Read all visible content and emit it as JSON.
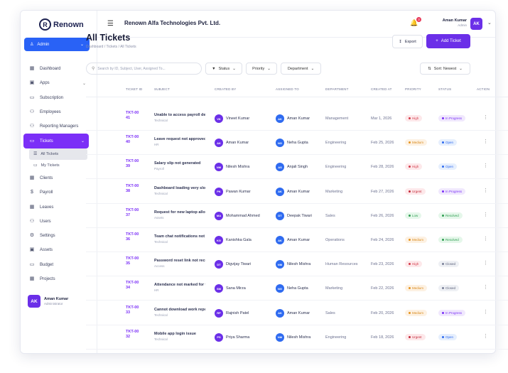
{
  "brand": {
    "name": "Renown",
    "mark": "R"
  },
  "role_switch": {
    "label": "Admin"
  },
  "sidebar": {
    "items": [
      {
        "label": "Dashboard",
        "icon": "grid-icon"
      },
      {
        "label": "Apps",
        "icon": "apps-icon",
        "has_children": true
      },
      {
        "label": "Subscription",
        "icon": "card-icon"
      },
      {
        "label": "Employees",
        "icon": "users-icon"
      },
      {
        "label": "Reporting Managers",
        "icon": "manager-icon"
      },
      {
        "label": "Tickets",
        "icon": "ticket-icon",
        "active": true,
        "has_children": true
      },
      {
        "label": "Clients",
        "icon": "building-icon"
      },
      {
        "label": "Payroll",
        "icon": "dollar-icon"
      },
      {
        "label": "Leaves",
        "icon": "calendar-icon"
      },
      {
        "label": "Users",
        "icon": "user-group-icon"
      },
      {
        "label": "Settings",
        "icon": "gear-icon"
      },
      {
        "label": "Assets",
        "icon": "box-icon"
      },
      {
        "label": "Budget",
        "icon": "wallet-icon"
      },
      {
        "label": "Projects",
        "icon": "folder-icon"
      }
    ],
    "tickets_children": [
      {
        "label": "All Tickets",
        "selected": true
      },
      {
        "label": "My Tickets",
        "selected": false
      }
    ],
    "footer_user": {
      "initials": "AK",
      "name": "Aman Kumar",
      "role": "Administrator"
    }
  },
  "topbar": {
    "company": "Renown Alfa Technologies Pvt. Ltd.",
    "notifications": "3",
    "user": {
      "name": "Aman Kumar",
      "role": "Admin",
      "initials": "AK"
    }
  },
  "page": {
    "title": "All Tickets",
    "breadcrumb": "Dashboard / Tickets / All Tickets",
    "export_label": "Export",
    "add_label": "Add Ticket"
  },
  "filters": {
    "search_placeholder": "Search by ID, Subject, User, Assigned To...",
    "status": "Status",
    "priority": "Priority",
    "department": "Department",
    "sort": "Sort: Newest"
  },
  "table": {
    "headers": [
      "TICKET ID",
      "SUBJECT",
      "CREATED BY",
      "ASSIGNED TO",
      "DEPARTMENT",
      "CREATED AT",
      "PRIORITY",
      "STATUS",
      "ACTION"
    ],
    "rows": [
      {
        "id": "TKT-0041",
        "subject": "Unable to access payroll details",
        "category": "Technical",
        "created_by": {
          "initials": "VK",
          "name": "Vineet Kumar"
        },
        "assigned_to": {
          "initials": "AK",
          "name": "Aman Kumar"
        },
        "department": "Management",
        "created_at": "Mar 1, 2026",
        "priority": "High",
        "status": "In Progress"
      },
      {
        "id": "TKT-0040",
        "subject": "Leave request not approved",
        "category": "HR",
        "created_by": {
          "initials": "AK",
          "name": "Aman Kumar"
        },
        "assigned_to": {
          "initials": "NG",
          "name": "Neha Gupta"
        },
        "department": "Engineering",
        "created_at": "Feb 25, 2026",
        "priority": "Medium",
        "status": "Open"
      },
      {
        "id": "TKT-0039",
        "subject": "Salary slip not generated",
        "category": "Payroll",
        "created_by": {
          "initials": "NM",
          "name": "Nilesh Mishra"
        },
        "assigned_to": {
          "initials": "AS",
          "name": "Anjali Singh"
        },
        "department": "Engineering",
        "created_at": "Feb 28, 2026",
        "priority": "High",
        "status": "Open"
      },
      {
        "id": "TKT-0038",
        "subject": "Dashboard loading very slow",
        "category": "Technical",
        "created_by": {
          "initials": "PK",
          "name": "Pawan Kumar"
        },
        "assigned_to": {
          "initials": "AK",
          "name": "Aman Kumar"
        },
        "department": "Marketing",
        "created_at": "Feb 27, 2026",
        "priority": "Urgent",
        "status": "In Progress"
      },
      {
        "id": "TKT-0037",
        "subject": "Request for new laptop allocation",
        "category": "Assets",
        "created_by": {
          "initials": "MA",
          "name": "Mohammad Ahmed"
        },
        "assigned_to": {
          "initials": "DT",
          "name": "Deepak Tiwari"
        },
        "department": "Sales",
        "created_at": "Feb 26, 2026",
        "priority": "Low",
        "status": "Resolved"
      },
      {
        "id": "TKT-0036",
        "subject": "Team chat notifications not working",
        "category": "Technical",
        "created_by": {
          "initials": "KG",
          "name": "Kanishka Gala"
        },
        "assigned_to": {
          "initials": "AK",
          "name": "Aman Kumar"
        },
        "department": "Operations",
        "created_at": "Feb 24, 2026",
        "priority": "Medium",
        "status": "Resolved"
      },
      {
        "id": "TKT-0035",
        "subject": "Password reset link not received",
        "category": "Access",
        "created_by": {
          "initials": "DT",
          "name": "Digvijay Tiwari"
        },
        "assigned_to": {
          "initials": "NM",
          "name": "Nilesh Mishra"
        },
        "department": "Human Resources",
        "created_at": "Feb 23, 2026",
        "priority": "High",
        "status": "Closed"
      },
      {
        "id": "TKT-0034",
        "subject": "Attendance not marked for today",
        "category": "HR",
        "created_by": {
          "initials": "SM",
          "name": "Sana Mirza"
        },
        "assigned_to": {
          "initials": "NG",
          "name": "Neha Gupta"
        },
        "department": "Marketing",
        "created_at": "Feb 22, 2026",
        "priority": "Medium",
        "status": "Closed"
      },
      {
        "id": "TKT-0033",
        "subject": "Cannot download work report",
        "category": "Technical",
        "created_by": {
          "initials": "RP",
          "name": "Rajnish Patel"
        },
        "assigned_to": {
          "initials": "AK",
          "name": "Aman Kumar"
        },
        "department": "Sales",
        "created_at": "Feb 20, 2026",
        "priority": "Medium",
        "status": "In Progress"
      },
      {
        "id": "TKT-0032",
        "subject": "Mobile app login issue",
        "category": "Technical",
        "created_by": {
          "initials": "PS",
          "name": "Priya Sharma"
        },
        "assigned_to": {
          "initials": "NM",
          "name": "Nilesh Mishra"
        },
        "department": "Engineering",
        "created_at": "Feb 18, 2026",
        "priority": "Urgent",
        "status": "Open"
      }
    ]
  },
  "colors": {
    "primary": "#7b2ff7",
    "accent_blue": "#2962f6"
  }
}
